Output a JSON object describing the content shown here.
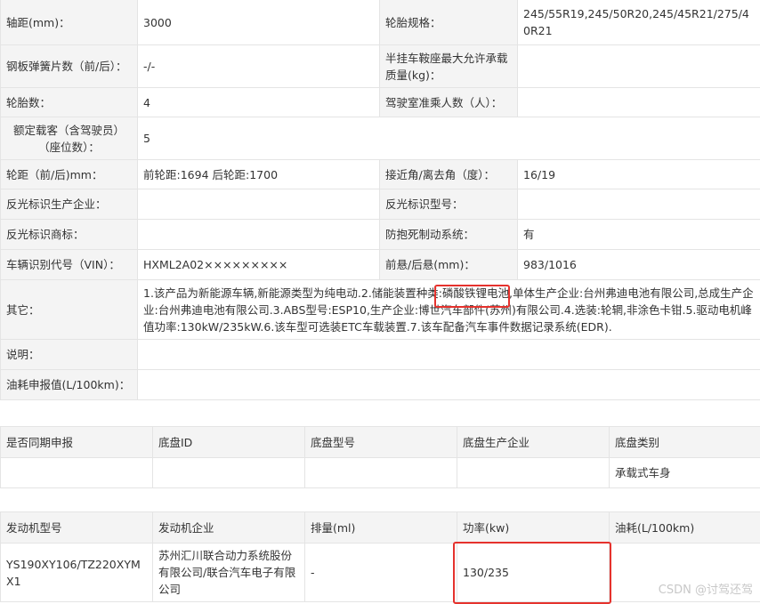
{
  "spec_table": {
    "rows": [
      {
        "l1": "轴距(mm)：",
        "v1": "3000",
        "l2": "轮胎规格：",
        "v2": "245/55R19,245/50R20,245/45R21/275/40R21"
      },
      {
        "l1": "钢板弹簧片数（前/后）：",
        "v1": "-/-",
        "l2": "半挂车鞍座最大允许承载质量(kg)：",
        "v2": ""
      },
      {
        "l1": "轮胎数：",
        "v1": "4",
        "l2": "驾驶室准乘人数（人）：",
        "v2": ""
      },
      {
        "l1": "额定载客（含驾驶员）（座位数）：",
        "v1": "5"
      },
      {
        "l1": "轮距（前/后)mm：",
        "v1": "前轮距:1694 后轮距:1700",
        "l2": "接近角/离去角（度）：",
        "v2": "16/19"
      },
      {
        "l1": "反光标识生产企业：",
        "v1": "",
        "l2": "反光标识型号：",
        "v2": ""
      },
      {
        "l1": "反光标识商标：",
        "v1": "",
        "l2": "防抱死制动系统：",
        "v2": "有"
      },
      {
        "l1": "车辆识别代号（VIN）：",
        "v1": "HXML2A02×××××××××",
        "l2": "前悬/后悬(mm)：",
        "v2": "983/1016"
      },
      {
        "l1": "其它：",
        "v1": "1.该产品为新能源车辆,新能源类型为纯电动.2.储能装置种类:磷酸铁锂电池,单体生产企业:台州弗迪电池有限公司,总成生产企业:台州弗迪电池有限公司.3.ABS型号:ESP10,生产企业:博世汽车部件(苏州)有限公司.4.选装:轮辋,非涂色卡钳.5.驱动电机峰值功率:130kW/235kW.6.该车型可选装ETC车载装置.7.该车配备汽车事件数据记录系统(EDR)."
      },
      {
        "l1": "说明：",
        "v1": ""
      },
      {
        "l1": "油耗申报值(L/100km)：",
        "v1": ""
      }
    ]
  },
  "chassis_table": {
    "headers": [
      "是否同期申报",
      "底盘ID",
      "底盘型号",
      "底盘生产企业",
      "底盘类别"
    ],
    "row": [
      "",
      "",
      "",
      "",
      "承载式车身"
    ]
  },
  "engine_table": {
    "headers": [
      "发动机型号",
      "发动机企业",
      "排量(ml)",
      "功率(kw)",
      "油耗(L/100km)"
    ],
    "row": [
      "YS190XY106/TZ220XYMX1",
      "苏州汇川联合动力系统股份有限公司/联合汽车电子有限公司",
      "-",
      "130/235",
      ""
    ]
  },
  "annotations": {
    "highlight_color": "#e5322d"
  },
  "watermark": "CSDN @讨驾还驾"
}
